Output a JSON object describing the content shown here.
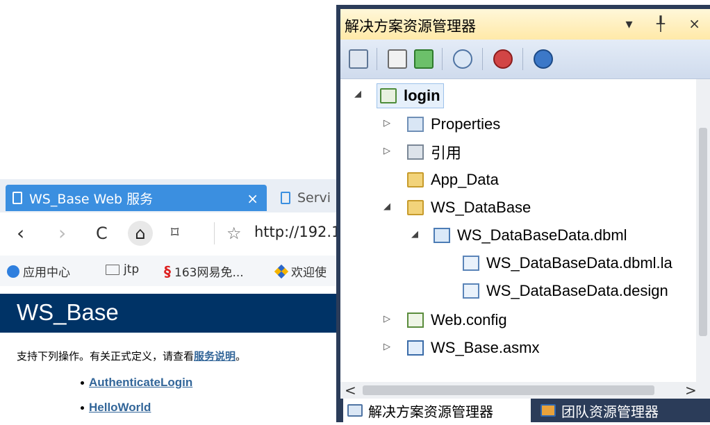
{
  "browser": {
    "tabs": [
      {
        "title": "WS_Base Web 服务",
        "close": "×",
        "active": true
      },
      {
        "title": "Servi",
        "active": false
      }
    ],
    "nav": {
      "back": "‹",
      "forward": "›",
      "reload": "C",
      "home": "⌂",
      "reader": "⌑",
      "star": "☆",
      "url": "http://192.1"
    },
    "bookmarks": [
      "应用中心",
      "jtp",
      "163网易免...",
      "欢迎使"
    ],
    "page": {
      "title": "WS_Base",
      "description_prefix": "支持下列操作。有关正式定义，请查看",
      "description_link": "服务说明",
      "description_suffix": "。",
      "operations": [
        "AuthenticateLogin",
        "HelloWorld"
      ]
    }
  },
  "solution_explorer": {
    "title": "解决方案资源管理器",
    "title_controls": "▾ ╀ ×",
    "toolbar_icons": [
      "show-all-files-icon",
      "properties-icon",
      "refresh-icon",
      "view-code-icon",
      "class-diagram-icon",
      "connect-icon"
    ],
    "tree": [
      {
        "label": "login",
        "icon": "csharp-project-icon",
        "expander": "◢",
        "selected": true
      },
      {
        "label": "Properties",
        "icon": "properties-folder-icon",
        "expander": "▷"
      },
      {
        "label": "引用",
        "icon": "references-icon",
        "expander": "▷"
      },
      {
        "label": "App_Data",
        "icon": "app-data-folder-icon",
        "expander": ""
      },
      {
        "label": "WS_DataBase",
        "icon": "open-folder-icon",
        "expander": "◢"
      },
      {
        "label": "WS_DataBaseData.dbml",
        "icon": "dbml-file-icon",
        "expander": "◢"
      },
      {
        "label": "WS_DataBaseData.dbml.la",
        "icon": "layout-file-icon",
        "expander": ""
      },
      {
        "label": "WS_DataBaseData.design",
        "icon": "designer-file-icon",
        "expander": ""
      },
      {
        "label": "Web.config",
        "icon": "config-file-icon",
        "expander": "▷"
      },
      {
        "label": "WS_Base.asmx",
        "icon": "asmx-file-icon",
        "expander": "▷"
      }
    ],
    "hscroll": {
      "left": "<",
      "right": ">"
    },
    "bottom_tabs": [
      "解决方案资源管理器",
      "团队资源管理器"
    ]
  },
  "colors": {
    "vs_frame": "#2b3c59",
    "ws_header": "#003366",
    "tab_active": "#3b8fe0",
    "link": "#336699"
  }
}
